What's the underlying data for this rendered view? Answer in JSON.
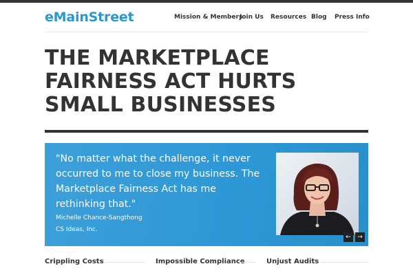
{
  "header": {
    "logo": "eMainStreet",
    "nav": [
      "Mission & Members",
      "Join Us",
      "Resources",
      "Blog",
      "Press Info"
    ]
  },
  "headline": "THE MARKETPLACE FAIRNESS ACT HURTS SMALL BUSINESSES",
  "slider": {
    "quote": "\"No matter what the challenge, it never occurred to me to close my business. The Marketplace Fairness Act has me rethinking that.\"",
    "name": "Michelle Chance-Sangthong",
    "organization": "CS Ideas, Inc.",
    "prev": "←",
    "next": "→"
  },
  "sections": [
    "Crippling Costs",
    "Impossible Compliance",
    "Unjust Audits"
  ],
  "colors": {
    "brand": "#2a97cf",
    "slider_bg": "#2e98d6",
    "text": "#333333"
  }
}
